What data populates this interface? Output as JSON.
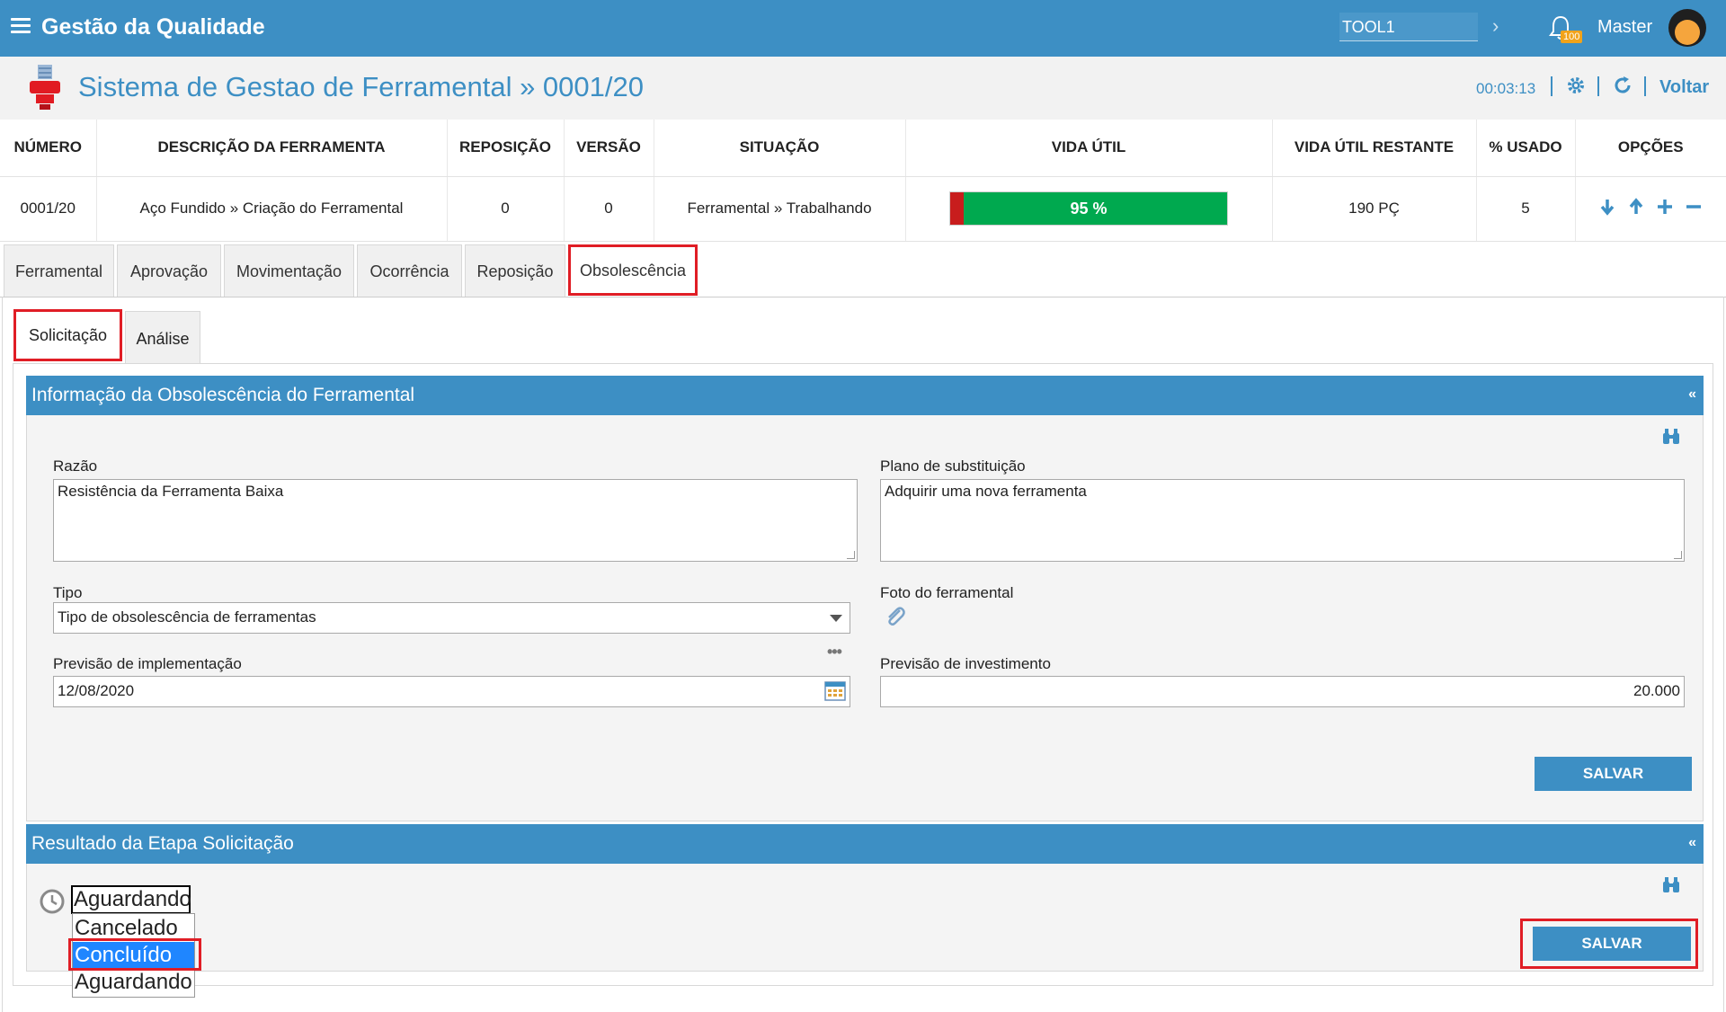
{
  "topbar": {
    "title": "Gestão da Qualidade",
    "search_value": "TOOL1",
    "notif_count": "100",
    "user": "Master"
  },
  "subheader": {
    "title": "Sistema de Gestao de Ferramental » 0001/20",
    "timer": "00:03:13",
    "back": "Voltar"
  },
  "summary": {
    "headers": [
      "NÚMERO",
      "DESCRIÇÃO DA FERRAMENTA",
      "REPOSIÇÃO",
      "VERSÃO",
      "SITUAÇÃO",
      "VIDA ÚTIL",
      "VIDA ÚTIL RESTANTE",
      "% USADO",
      "OPÇÕES"
    ],
    "row": {
      "numero": "0001/20",
      "descricao": "Aço Fundido » Criação do Ferramental",
      "reposicao": "0",
      "versao": "0",
      "situacao": "Ferramental » Trabalhando",
      "vida_util_label": "95 %",
      "vida_util_fraction": 0.95,
      "vida_restante": "190 PÇ",
      "usado": "5"
    }
  },
  "tabs": [
    "Ferramental",
    "Aprovação",
    "Movimentação",
    "Ocorrência",
    "Reposição",
    "Obsolescência"
  ],
  "subtabs": [
    "Solicitação",
    "Análise"
  ],
  "info_panel": {
    "title": "Informação da Obsolescência do Ferramental",
    "collapse": "«",
    "razao_label": "Razão",
    "razao_value": "Resistência da Ferramenta Baixa",
    "plano_label": "Plano de substituição",
    "plano_value": "Adquirir uma nova ferramenta",
    "tipo_label": "Tipo",
    "tipo_value": "Tipo de obsolescência de ferramentas",
    "foto_label": "Foto do ferramental",
    "prev_impl_label": "Previsão de implementação",
    "prev_impl_value": "12/08/2020",
    "prev_inv_label": "Previsão de investimento",
    "prev_inv_value": "20.000",
    "save": "SALVAR"
  },
  "result_panel": {
    "title": "Resultado da Etapa Solicitação",
    "collapse": "«",
    "status_value": "Aguardando",
    "options": [
      "Cancelado",
      "Concluído",
      "Aguardando"
    ],
    "save": "SALVAR"
  },
  "colors": {
    "primary": "#3d8fc4",
    "highlight": "#e01d25",
    "life_green": "#00a94f",
    "life_red": "#c81d1d"
  }
}
